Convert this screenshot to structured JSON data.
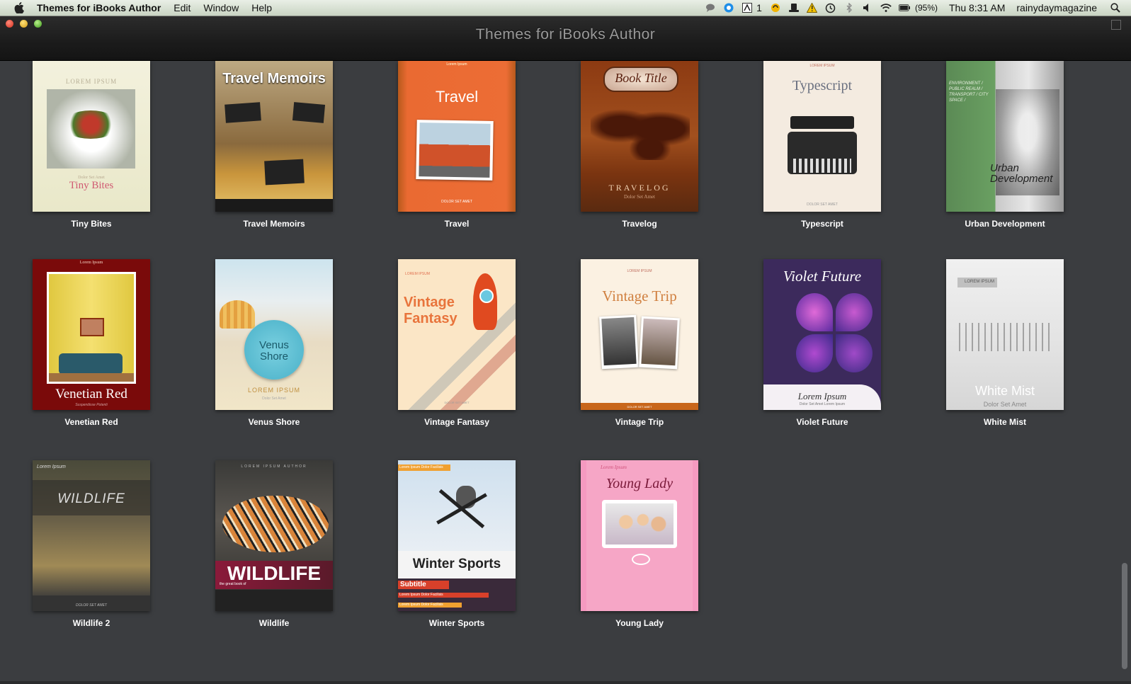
{
  "menubar": {
    "app_name": "Themes for iBooks Author",
    "menus": [
      "Edit",
      "Window",
      "Help"
    ],
    "adobe_badge": "1",
    "battery": "(95%)",
    "clock": "Thu 8:31 AM",
    "user": "rainydaymagazine"
  },
  "window": {
    "title": "Themes for iBooks Author"
  },
  "themes": [
    {
      "name": "Tiny Bites",
      "cover": {
        "top": "LOREM IPSUM",
        "sub": "Dolor Set Amet",
        "title": "Tiny Bites"
      }
    },
    {
      "name": "Travel Memoirs",
      "cover": {
        "title": "Travel Memoirs"
      }
    },
    {
      "name": "Travel",
      "cover": {
        "top": "Lorem Ipsum",
        "title": "Travel",
        "bottom": "DOLOR SET AMET"
      }
    },
    {
      "name": "Travelog",
      "cover": {
        "top": "Book Title",
        "title": "TRAVELOG",
        "sub": "Dolor Set Amet"
      }
    },
    {
      "name": "Typescript",
      "cover": {
        "top": "LOREM IPSUM",
        "title": "Typescript",
        "bottom": "DOLOR SET AMET"
      }
    },
    {
      "name": "Urban Development",
      "cover": {
        "top": "ENVIRONMENT / PUBLIC REALM / TRANSPORT / CITY SPACE /",
        "title": "Urban Development"
      }
    },
    {
      "name": "Venetian Red",
      "cover": {
        "top": "Lorem Ipsum",
        "title": "Venetian Red",
        "sub": "Suspendisse Potenti"
      }
    },
    {
      "name": "Venus Shore",
      "cover": {
        "title": "Venus Shore",
        "top": "LOREM IPSUM",
        "sub": "Dolor Set Amet"
      }
    },
    {
      "name": "Vintage Fantasy",
      "cover": {
        "top": "LOREM IPSUM",
        "title": "Vintage Fantasy",
        "bottom": "DOLOR SET AMET"
      }
    },
    {
      "name": "Vintage Trip",
      "cover": {
        "top": "LOREM IPSUM",
        "title": "Vintage Trip",
        "bottom": "DOLOR SET AMET"
      }
    },
    {
      "name": "Violet Future",
      "cover": {
        "title": "Violet Future",
        "top": "Lorem Ipsum",
        "sub": "Dolor Set Amet Lorem Ipsum"
      }
    },
    {
      "name": "White Mist",
      "cover": {
        "top": "LOREM IPSUM",
        "title": "White Mist",
        "sub": "Dolor Set Amet"
      }
    },
    {
      "name": "Wildlife 2",
      "cover": {
        "top": "Lorem Ipsum",
        "title": "WILDLIFE",
        "bottom": "DOLOR SET AMET"
      }
    },
    {
      "name": "Wildlife",
      "cover": {
        "top": "LOREM IPSUM AUTHOR",
        "title": "WILDLIFE",
        "sub": "the great book of"
      }
    },
    {
      "name": "Winter Sports",
      "cover": {
        "top": "Lorem Ipsum Dolor Facilisis",
        "title": "Winter Sports",
        "sub": "Subtitle",
        "line1": "Lorem Ipsum Dolor Facilisis",
        "line2": "Lorem Ipsum Dolor Facilisis"
      }
    },
    {
      "name": "Young Lady",
      "cover": {
        "top": "Lorem Ipsum",
        "title": "Young Lady"
      }
    }
  ]
}
